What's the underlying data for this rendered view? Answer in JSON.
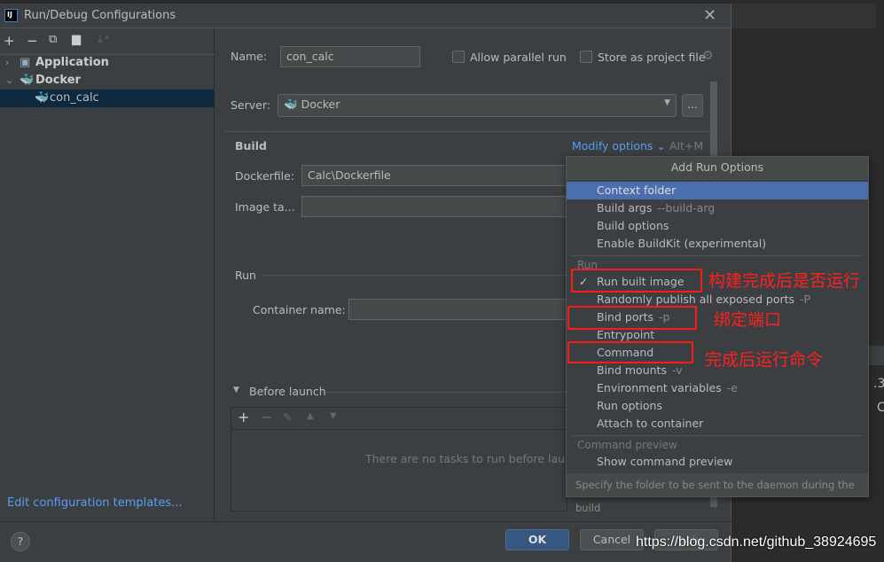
{
  "window": {
    "title": "Run/Debug Configurations",
    "logo": "IJ"
  },
  "toolbar_icons": [
    "add-icon",
    "remove-icon",
    "copy-icon",
    "folder-add-icon",
    "sort-icon"
  ],
  "tree": [
    {
      "label": "Application",
      "expanded": false
    },
    {
      "label": "Docker",
      "expanded": true,
      "children": [
        {
          "label": "con_calc",
          "selected": true
        }
      ]
    }
  ],
  "edit_templates": "Edit configuration templates...",
  "form": {
    "name_label": "Name:",
    "name_value": "con_calc",
    "allow_parallel": "Allow parallel run",
    "store_project": "Store as project file",
    "server_label": "Server:",
    "server_value": "Docker",
    "browse": "...",
    "build_heading": "Build",
    "modify_options": "Modify options",
    "modify_shortcut": "Alt+M",
    "dockerfile_label": "Dockerfile:",
    "dockerfile_value": "Calc\\Dockerfile",
    "image_tag_label": "Image ta...",
    "run_heading": "Run",
    "container_name_label": "Container name:",
    "before_launch": "Before launch",
    "no_tasks": "There are no tasks to run before launch"
  },
  "menu": {
    "title": "Add Run Options",
    "items": [
      {
        "label": "Context folder",
        "highlighted": true
      },
      {
        "label": "Build args",
        "hint": "--build-arg"
      },
      {
        "label": "Build options"
      },
      {
        "label": "Enable BuildKit (experimental)"
      },
      {
        "group": "Run"
      },
      {
        "label": "Run built image",
        "checked": true
      },
      {
        "label": "Randomly publish all exposed ports",
        "hint": "-P"
      },
      {
        "label": "Bind ports",
        "hint": "-p"
      },
      {
        "label": "Entrypoint"
      },
      {
        "label": "Command"
      },
      {
        "label": "Bind mounts",
        "hint": "-v"
      },
      {
        "label": "Environment variables",
        "hint": "-e"
      },
      {
        "label": "Run options"
      },
      {
        "label": "Attach to container"
      },
      {
        "group": "Command preview"
      },
      {
        "label": "Show command preview"
      }
    ],
    "footer": "Specify the folder to be sent to the daemon during the build"
  },
  "annotations": {
    "run_built": "构建完成后是否运行",
    "bind_ports": "绑定端口",
    "command": "完成后运行命令"
  },
  "buttons": {
    "ok": "OK",
    "cancel": "Cancel",
    "apply": "Apply",
    "help": "?"
  },
  "background_text": [
    ".3",
    "C"
  ],
  "watermark": "https://blog.csdn.net/github_38924695",
  "colors": {
    "accent": "#4b6eaf",
    "link": "#589df6",
    "annotation": "#ff1a1a"
  }
}
